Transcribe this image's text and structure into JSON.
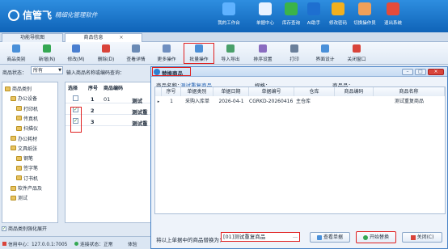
{
  "app": {
    "brand": "信管飞",
    "subtitle": "精细化管理软件"
  },
  "header_menu": [
    {
      "label": "我的工作台",
      "icon": "monitor-icon",
      "color": "#5fb2ff"
    },
    {
      "label": "单据中心",
      "icon": "document-icon",
      "color": "#e9f2ff"
    },
    {
      "label": "库存查询",
      "icon": "spreadsheet-icon",
      "color": "#3bb34a"
    },
    {
      "label": "AI助手",
      "icon": "info-icon",
      "color": "#1e6fd0"
    },
    {
      "label": "修改密码",
      "icon": "lock-icon",
      "color": "#f2b01e"
    },
    {
      "label": "切换操作员",
      "icon": "user-icon",
      "color": "#f0a05a"
    },
    {
      "label": "退出系统",
      "icon": "power-icon",
      "color": "#e44b3a"
    }
  ],
  "tabs": [
    {
      "label": "功能导航图"
    },
    {
      "label": "商品信息"
    }
  ],
  "toolbar": [
    {
      "label": "商品类别",
      "icon": "category-icon",
      "color": "#4a90d9"
    },
    {
      "label": "新增(N)",
      "icon": "add-icon",
      "color": "#35a853"
    },
    {
      "label": "修改(M)",
      "icon": "edit-icon",
      "color": "#4a7fd0"
    },
    {
      "label": "删除(D)",
      "icon": "delete-icon",
      "color": "#d9443a"
    },
    {
      "label": "查看详情",
      "icon": "view-icon",
      "color": "#6b8bb5"
    },
    {
      "label": "更多操作",
      "icon": "more-icon",
      "color": "#6f8fc0"
    },
    {
      "label": "批量操作",
      "icon": "batch-icon",
      "color": "#4c8fd6"
    },
    {
      "label": "导入导出",
      "icon": "import-icon",
      "color": "#4aa06a"
    },
    {
      "label": "排序设置",
      "icon": "sort-icon",
      "color": "#8a6cc0"
    },
    {
      "label": "打印",
      "icon": "print-icon",
      "color": "#6a7f9a"
    },
    {
      "label": "界面设计",
      "icon": "design-icon",
      "color": "#4a90d9"
    },
    {
      "label": "关闭窗口",
      "icon": "close-window-icon",
      "color": "#d9443a"
    }
  ],
  "filter": {
    "label": "商品状态：",
    "value": "所有",
    "search_label": "输入商品名称或编码查询："
  },
  "tree": [
    {
      "label": "商品类别",
      "indent": 0
    },
    {
      "label": "办公设备",
      "indent": 1
    },
    {
      "label": "打印机",
      "indent": 2
    },
    {
      "label": "传真机",
      "indent": 2
    },
    {
      "label": "扫描仪",
      "indent": 2
    },
    {
      "label": "办公耗材",
      "indent": 1
    },
    {
      "label": "文具纸张",
      "indent": 1
    },
    {
      "label": "钢笔",
      "indent": 2
    },
    {
      "label": "签字笔",
      "indent": 2
    },
    {
      "label": "订书机",
      "indent": 2
    },
    {
      "label": "软件产品及",
      "indent": 1
    },
    {
      "label": "测试",
      "indent": 1
    }
  ],
  "grid": {
    "headers": [
      "选择",
      "序号",
      "商品编码"
    ],
    "rows": [
      {
        "checked": false,
        "no": "1",
        "code": "01",
        "name": "测试"
      },
      {
        "checked": true,
        "no": "2",
        "code": "",
        "name": "测试重"
      },
      {
        "checked": true,
        "no": "3",
        "code": "",
        "name": "测试重"
      }
    ]
  },
  "tree_option": "商品类别强化展开",
  "status": {
    "db": "信用中心：127.0.0.1:7005",
    "conn": "连接状态：正常",
    "mode": "体验"
  },
  "dialog": {
    "title": "替换商品",
    "name_label": "商品名称：",
    "name_value": "测试重复商品",
    "spec_label": "规格：",
    "spec_value": "",
    "unit_label": "商品品：",
    "unit_value": "",
    "headers": [
      "序号",
      "单据类别",
      "单据日期",
      "单据编号",
      "仓库",
      "商品编码",
      "商品名称"
    ],
    "row": {
      "no": "1",
      "type": "采购入库单",
      "date": "2026-04-1",
      "number": "CGRKD-20260416",
      "warehouse": "主仓库",
      "code": "",
      "name": "测试重复商品"
    },
    "replace_label": "将以上单据中的商品替换为：",
    "replace_value": "[01]测试重复商品",
    "btn_view": "查看单据",
    "btn_start": "开始替换",
    "btn_close": "关闭(C)"
  }
}
